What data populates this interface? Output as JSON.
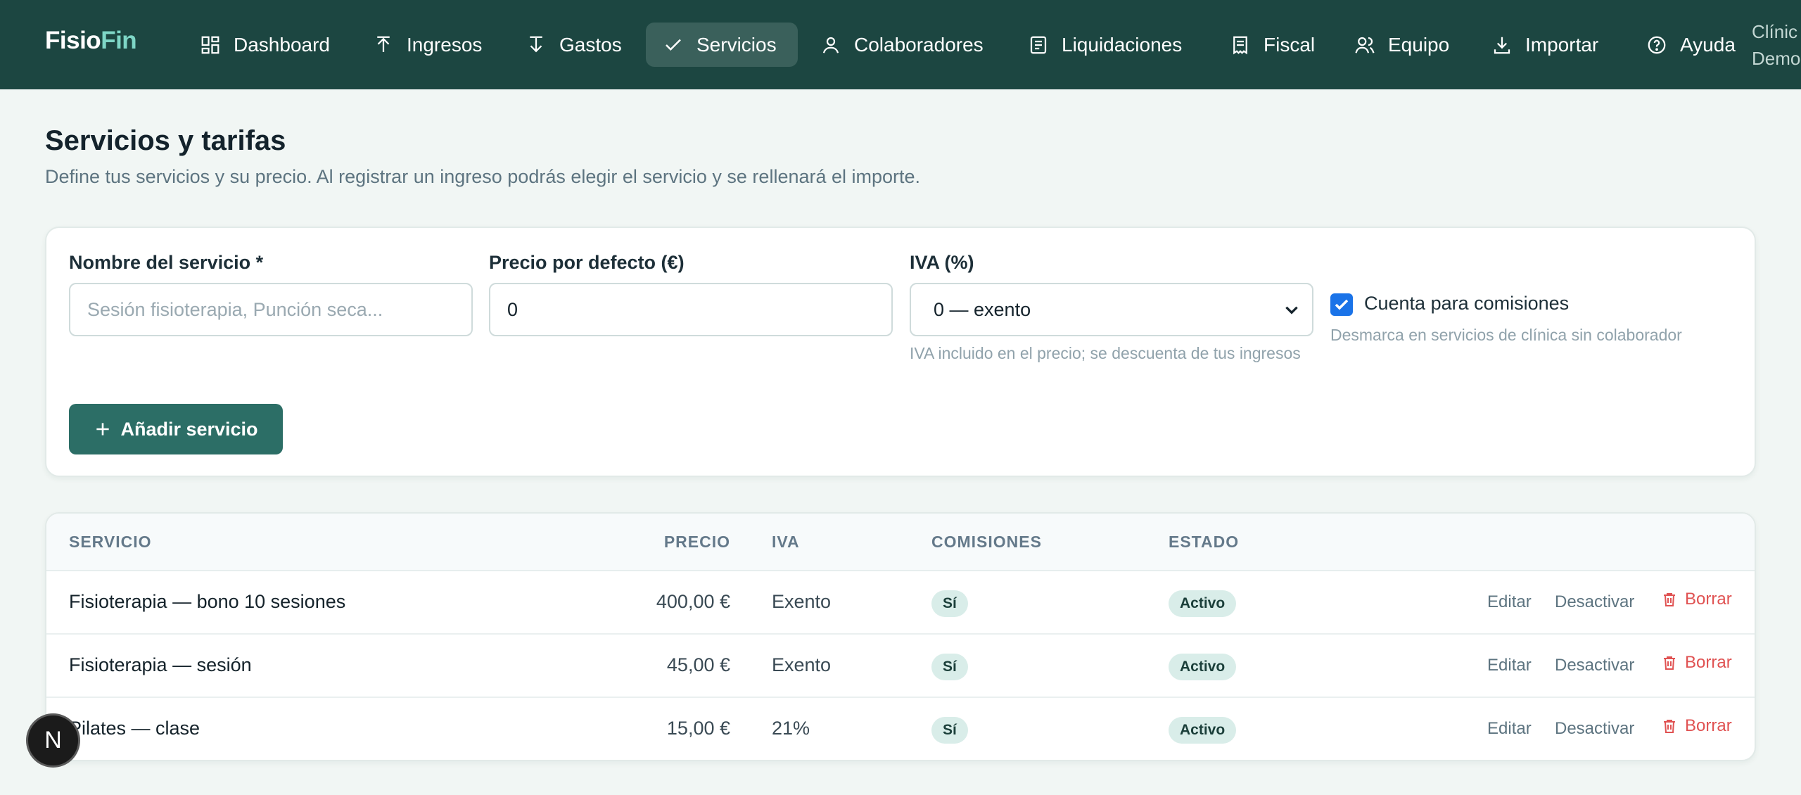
{
  "brand": {
    "part1": "Fisio",
    "part2": "Fin"
  },
  "nav": {
    "items": [
      {
        "label": "Dashboard",
        "icon": "dashboard-icon"
      },
      {
        "label": "Ingresos",
        "icon": "arrow-up-icon"
      },
      {
        "label": "Gastos",
        "icon": "arrow-down-icon"
      },
      {
        "label": "Servicios",
        "icon": "check-icon",
        "active": true
      },
      {
        "label": "Colaboradores",
        "icon": "user-icon"
      },
      {
        "label": "Liquidaciones",
        "icon": "document-icon"
      },
      {
        "label": "Fiscal",
        "icon": "receipt-icon"
      },
      {
        "label": "Equipo",
        "icon": "users-icon"
      },
      {
        "label": "Importar",
        "icon": "download-icon"
      },
      {
        "label": "Ayuda",
        "icon": "help-icon"
      }
    ],
    "clinic_line1": "Clínic",
    "clinic_line2": "Demo"
  },
  "page": {
    "title": "Servicios y tarifas",
    "subtitle": "Define tus servicios y su precio. Al registrar un ingreso podrás elegir el servicio y se rellenará el importe."
  },
  "form": {
    "name_label": "Nombre del servicio *",
    "name_placeholder": "Sesión fisioterapia, Punción seca...",
    "price_label": "Precio por defecto (€)",
    "price_value": "0",
    "iva_label": "IVA (%)",
    "iva_selected": "0 — exento",
    "iva_hint": "IVA incluido en el precio; se descuenta de tus ingresos",
    "commission_label": "Cuenta para comisiones",
    "commission_checked": true,
    "commission_hint": "Desmarca en servicios de clínica sin colaborador",
    "add_button": "Añadir servicio"
  },
  "table": {
    "headers": [
      "SERVICIO",
      "PRECIO",
      "IVA",
      "COMISIONES",
      "ESTADO"
    ],
    "rows": [
      {
        "servicio": "Fisioterapia — bono 10 sesiones",
        "precio": "400,00 €",
        "iva": "Exento",
        "comisiones": "Sí",
        "estado": "Activo"
      },
      {
        "servicio": "Fisioterapia — sesión",
        "precio": "45,00 €",
        "iva": "Exento",
        "comisiones": "Sí",
        "estado": "Activo"
      },
      {
        "servicio": "Pilates — clase",
        "precio": "15,00 €",
        "iva": "21%",
        "comisiones": "Sí",
        "estado": "Activo"
      }
    ],
    "actions": {
      "edit": "Editar",
      "deactivate": "Desactivar",
      "delete": "Borrar"
    }
  },
  "fab": {
    "letter": "N"
  },
  "colors": {
    "nav_bg": "#1c4641",
    "accent": "#2c6e66",
    "brand_accent": "#7ed6c6",
    "danger": "#e05252"
  }
}
